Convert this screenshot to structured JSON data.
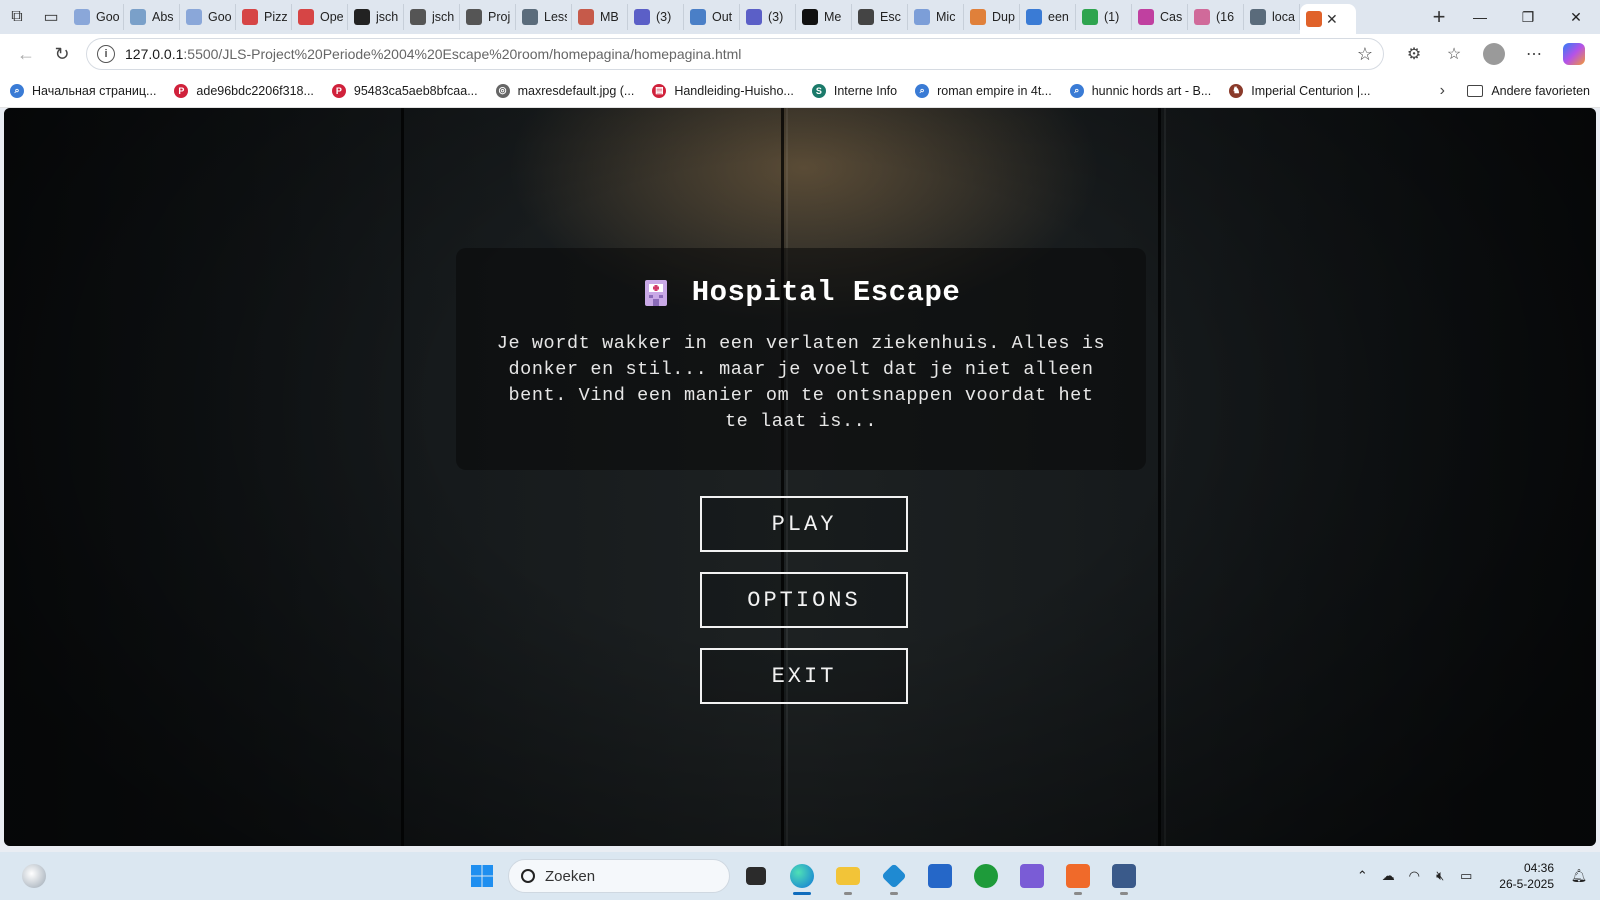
{
  "browser": {
    "tabs": [
      {
        "label": "Goo",
        "color": "#8aa7d9"
      },
      {
        "label": "Abs",
        "color": "#7aa0c9"
      },
      {
        "label": "Goo",
        "color": "#8aa7d9"
      },
      {
        "label": "Pizz",
        "color": "#d64545"
      },
      {
        "label": "Ope",
        "color": "#d64545"
      },
      {
        "label": "jsch",
        "color": "#222222"
      },
      {
        "label": "jsch",
        "color": "#555555"
      },
      {
        "label": "Proj",
        "color": "#555555"
      },
      {
        "label": "Less",
        "color": "#5a6b7b"
      },
      {
        "label": "MB",
        "color": "#c65a4a"
      },
      {
        "label": "(3)",
        "color": "#5b5fc7"
      },
      {
        "label": "Out",
        "color": "#4a7fc7"
      },
      {
        "label": "(3)",
        "color": "#5b5fc7"
      },
      {
        "label": "Me",
        "color": "#111111"
      },
      {
        "label": "Esc",
        "color": "#444444"
      },
      {
        "label": "Mic",
        "color": "#7c9ed8"
      },
      {
        "label": "Dup",
        "color": "#e0803a"
      },
      {
        "label": "een",
        "color": "#3a7bd5"
      },
      {
        "label": "(1)",
        "color": "#2ea44f"
      },
      {
        "label": "Cas",
        "color": "#c040a0"
      },
      {
        "label": "(16",
        "color": "#d06a9a"
      },
      {
        "label": "loca",
        "color": "#5a6b7b"
      }
    ],
    "active_tab": {
      "label": "",
      "color": "#e0622a"
    },
    "url_host": "127.0.0.1",
    "url_path": ":5500/JLS-Project%20Periode%2004%20Escape%20room/homepagina/homepagina.html",
    "bookmarks": [
      {
        "label": "Начальная страниц...",
        "color": "#3a7bd5",
        "glyph": "⌕"
      },
      {
        "label": "ade96bdc2206f318...",
        "color": "#d0213b",
        "glyph": "P"
      },
      {
        "label": "95483ca5aeb8bfcaa...",
        "color": "#d0213b",
        "glyph": "P"
      },
      {
        "label": "maxresdefault.jpg (...",
        "color": "#666666",
        "glyph": "◎"
      },
      {
        "label": "Handleiding-Huisho...",
        "color": "#d0213b",
        "glyph": "▤"
      },
      {
        "label": "Interne Info",
        "color": "#1b7a6a",
        "glyph": "S"
      },
      {
        "label": "roman empire in 4t...",
        "color": "#3a7bd5",
        "glyph": "⌕"
      },
      {
        "label": "hunnic hords art - B...",
        "color": "#3a7bd5",
        "glyph": "⌕"
      },
      {
        "label": "Imperial Centurion |...",
        "color": "#8a3a2a",
        "glyph": "♞"
      }
    ],
    "other_favorites": "Andere favorieten"
  },
  "game": {
    "title": "Hospital Escape",
    "description": "Je wordt wakker in een verlaten ziekenhuis. Alles is donker en stil... maar je voelt dat je niet alleen bent. Vind een manier om te ontsnappen voordat het te laat is...",
    "buttons": {
      "play": "PLAY",
      "options": "OPTIONS",
      "exit": "EXIT"
    }
  },
  "taskbar": {
    "search_placeholder": "Zoeken",
    "time": "04:36",
    "date": "26-5-2025"
  }
}
